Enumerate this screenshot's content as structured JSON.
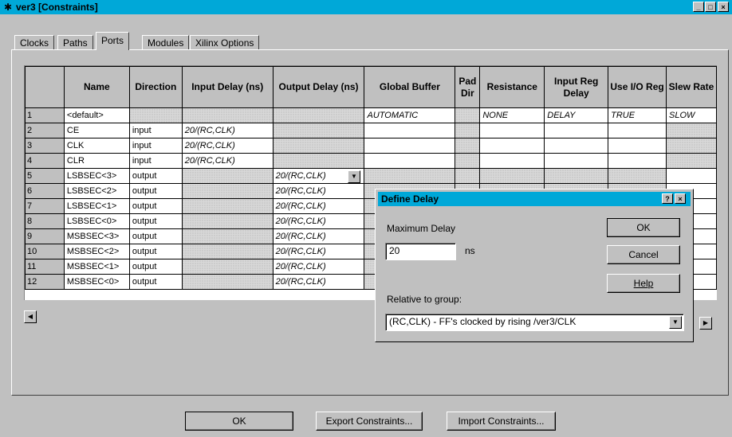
{
  "window": {
    "title": "ver3 [Constraints]",
    "buttons": [
      "_",
      "□",
      "×"
    ]
  },
  "tabs": [
    "Clocks",
    "Paths",
    "Ports",
    "Modules",
    "Xilinx Options"
  ],
  "active_tab": "Ports",
  "table": {
    "headers": [
      "Name",
      "Direction",
      "Input Delay (ns)",
      "Output Delay (ns)",
      "Global Buffer",
      "Pad Dir",
      "Resistance",
      "Input Reg Delay",
      "Use I/O Reg",
      "Slew Rate"
    ],
    "rows": [
      {
        "num": "1",
        "name": "<default>",
        "direction": "",
        "input_delay": "",
        "output_delay": "",
        "global_buffer": "AUTOMATIC",
        "resistance": "NONE",
        "input_reg_delay": "DELAY",
        "use_io_reg": "TRUE",
        "slew_rate": "SLOW"
      },
      {
        "num": "2",
        "name": "CE",
        "direction": "input",
        "input_delay": "20/(RC,CLK)",
        "output_delay": "",
        "global_buffer": "",
        "resistance": "",
        "input_reg_delay": "",
        "use_io_reg": "",
        "slew_rate": ""
      },
      {
        "num": "3",
        "name": "CLK",
        "direction": "input",
        "input_delay": "20/(RC,CLK)",
        "output_delay": "",
        "global_buffer": "",
        "resistance": "",
        "input_reg_delay": "",
        "use_io_reg": "",
        "slew_rate": ""
      },
      {
        "num": "4",
        "name": "CLR",
        "direction": "input",
        "input_delay": "20/(RC,CLK)",
        "output_delay": "",
        "global_buffer": "",
        "resistance": "",
        "input_reg_delay": "",
        "use_io_reg": "",
        "slew_rate": ""
      },
      {
        "num": "5",
        "name": "LSBSEC<3>",
        "direction": "output",
        "input_delay": "",
        "output_delay": "20/(RC,CLK)",
        "global_buffer": "",
        "resistance": "",
        "input_reg_delay": "",
        "use_io_reg": "",
        "slew_rate": ""
      },
      {
        "num": "6",
        "name": "LSBSEC<2>",
        "direction": "output",
        "input_delay": "",
        "output_delay": "20/(RC,CLK)",
        "global_buffer": "",
        "resistance": "",
        "input_reg_delay": "",
        "use_io_reg": "",
        "slew_rate": ""
      },
      {
        "num": "7",
        "name": "LSBSEC<1>",
        "direction": "output",
        "input_delay": "",
        "output_delay": "20/(RC,CLK)",
        "global_buffer": "",
        "resistance": "",
        "input_reg_delay": "",
        "use_io_reg": "",
        "slew_rate": ""
      },
      {
        "num": "8",
        "name": "LSBSEC<0>",
        "direction": "output",
        "input_delay": "",
        "output_delay": "20/(RC,CLK)",
        "global_buffer": "",
        "resistance": "",
        "input_reg_delay": "",
        "use_io_reg": "",
        "slew_rate": ""
      },
      {
        "num": "9",
        "name": "MSBSEC<3>",
        "direction": "output",
        "input_delay": "",
        "output_delay": "20/(RC,CLK)",
        "global_buffer": "",
        "resistance": "",
        "input_reg_delay": "",
        "use_io_reg": "",
        "slew_rate": ""
      },
      {
        "num": "10",
        "name": "MSBSEC<2>",
        "direction": "output",
        "input_delay": "",
        "output_delay": "20/(RC,CLK)",
        "global_buffer": "",
        "resistance": "",
        "input_reg_delay": "",
        "use_io_reg": "",
        "slew_rate": ""
      },
      {
        "num": "11",
        "name": "MSBSEC<1>",
        "direction": "output",
        "input_delay": "",
        "output_delay": "20/(RC,CLK)",
        "global_buffer": "",
        "resistance": "",
        "input_reg_delay": "",
        "use_io_reg": "",
        "slew_rate": ""
      },
      {
        "num": "12",
        "name": "MSBSEC<0>",
        "direction": "output",
        "input_delay": "",
        "output_delay": "20/(RC,CLK)",
        "global_buffer": "",
        "resistance": "",
        "input_reg_delay": "",
        "use_io_reg": "",
        "slew_rate": ""
      }
    ]
  },
  "dialog": {
    "title": "Define Delay",
    "max_delay_label": "Maximum Delay",
    "max_delay_value": "20",
    "unit": "ns",
    "relative_label": "Relative to group:",
    "relative_value": "(RC,CLK) - FF's clocked by rising /ver3/CLK",
    "ok": "OK",
    "cancel": "Cancel",
    "help": "Help"
  },
  "footer": {
    "ok": "OK",
    "export": "Export Constraints...",
    "import": "Import Constraints..."
  },
  "colors": {
    "titlebar": "#00a8d8",
    "face": "#c0c0c0"
  }
}
